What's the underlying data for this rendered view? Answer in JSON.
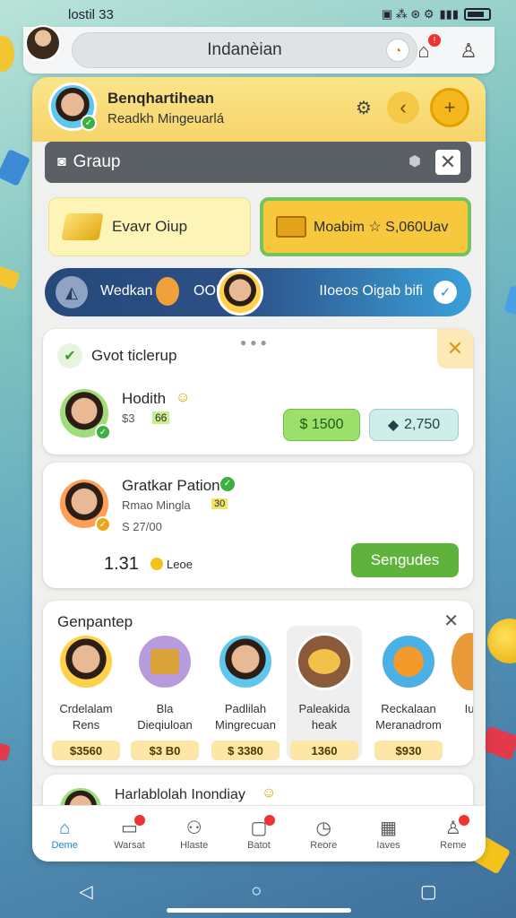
{
  "status": {
    "time": "lostil 33",
    "icons": "▣ ⁂ ⊛ ⚙"
  },
  "topbar": {
    "search_text": "Indanèian"
  },
  "profile": {
    "name": "Benqhartihean",
    "subtitle": "Readkh Mingeuarlá"
  },
  "group": {
    "label": "Graup"
  },
  "buttons": {
    "left": "Evavr Oiup",
    "right": "Moabim ☆ S,060Uav"
  },
  "info": {
    "left": "Wedkan",
    "counter": "OOI",
    "right": "IIoeos Oigab bifi"
  },
  "card1": {
    "title": "Gvot ticlerup",
    "user": "Hodith",
    "user_value": "$3",
    "user_tag": "66",
    "pill_a": "$ 1500",
    "pill_b": "2,750"
  },
  "card2": {
    "name": "Gratkar Pation",
    "subtitle": "Rmao Mingla",
    "subtitle_tag": "30",
    "price": "S 27/00",
    "amount": "1.31",
    "amount_label": "Leoe",
    "cta": "Sengudes"
  },
  "card3": {
    "title": "Genpantep",
    "members": [
      {
        "name1": "Crdelalam",
        "name2": "Rens",
        "price": "$3560"
      },
      {
        "name1": "Bla",
        "name2": "Dieqiuloan",
        "price": "$3 B0"
      },
      {
        "name1": "Padlilah",
        "name2": "Mingrecuan",
        "price": "$ 3380"
      },
      {
        "name1": "Paleakida",
        "name2": "heak",
        "price": "1360"
      },
      {
        "name1": "Reckalaan",
        "name2": "Meranadrom",
        "price": "$930"
      },
      {
        "name1": "Iu",
        "name2": "",
        "price": ""
      }
    ]
  },
  "card4": {
    "title": "Harlablolah Inondiay"
  },
  "nav": [
    {
      "label": "Deme",
      "icon": "home-icon"
    },
    {
      "label": "Warsat",
      "icon": "chat-icon"
    },
    {
      "label": "Hlaste",
      "icon": "people-icon"
    },
    {
      "label": "Batot",
      "icon": "bag-icon"
    },
    {
      "label": "Reore",
      "icon": "clock-icon"
    },
    {
      "label": "Iaves",
      "icon": "grid-icon"
    },
    {
      "label": "Reme",
      "icon": "person-icon"
    }
  ]
}
